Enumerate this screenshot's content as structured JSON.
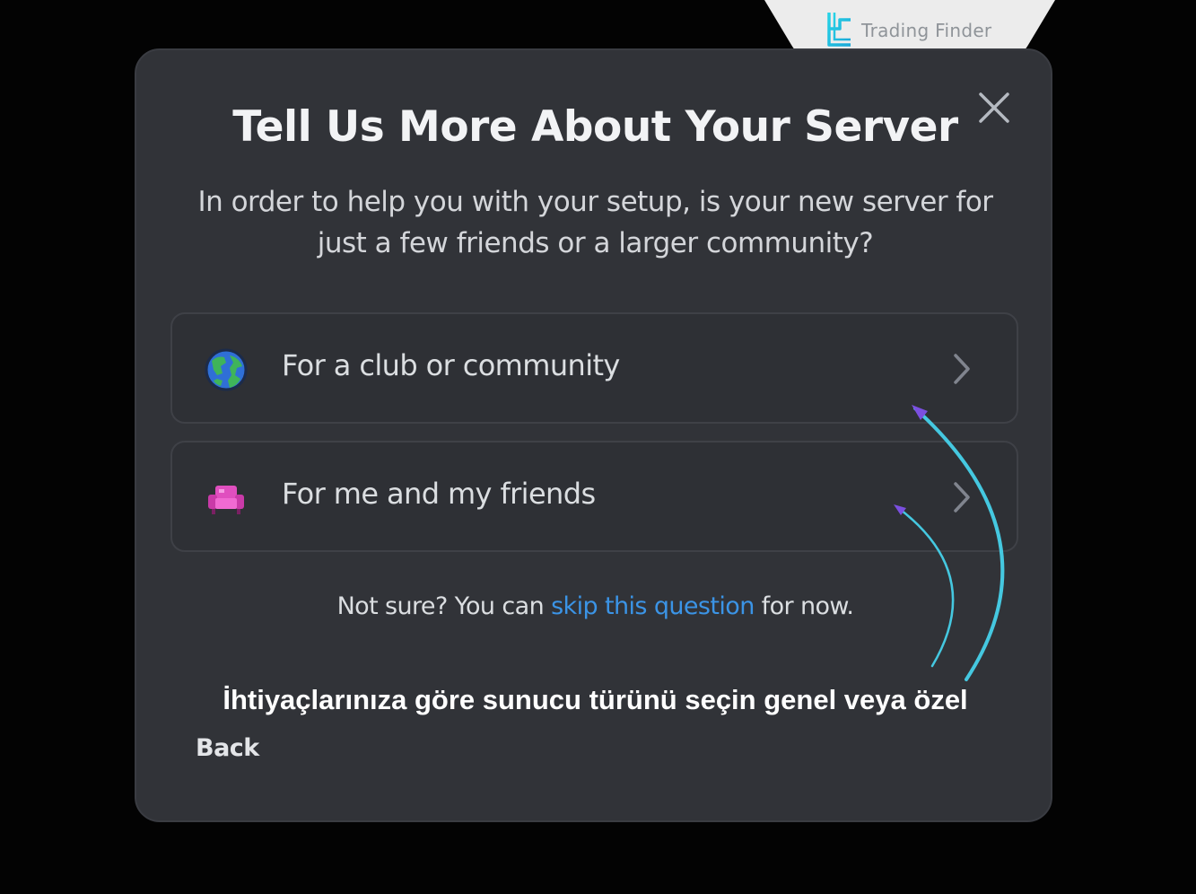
{
  "brand": {
    "name": "Trading Finder",
    "logo_icon": "trading-finder-logo"
  },
  "modal": {
    "title": "Tell Us More About Your Server",
    "subtitle": "In order to help you with your setup, is your new server for just a few friends or a larger community?",
    "close_icon": "close-icon",
    "options": [
      {
        "label": "For a club or community",
        "icon": "globe-icon"
      },
      {
        "label": "For me and my friends",
        "icon": "couch-icon"
      }
    ],
    "skip": {
      "prefix": "Not sure? You can ",
      "link": "skip this question",
      "suffix": " for now."
    },
    "back_label": "Back"
  },
  "annotation": {
    "caption": "İhtiyaçlarınıza göre sunucu türünü seçin genel veya özel"
  },
  "colors": {
    "modal_bg": "#313338",
    "link": "#3b94e6",
    "arrow": "#45c8e0",
    "arrow_head": "#7b4fe0"
  }
}
